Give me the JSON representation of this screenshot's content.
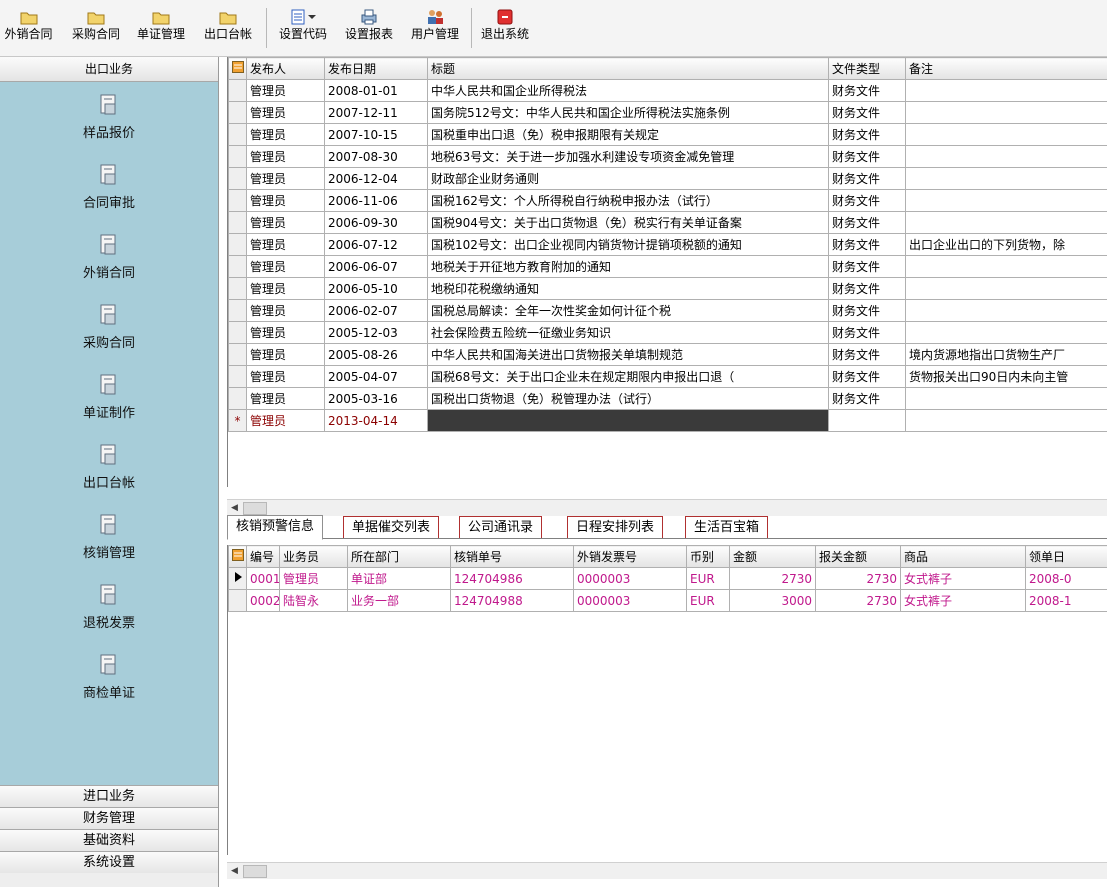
{
  "toolbar": {
    "buttons": [
      {
        "label": "外销合同",
        "icon": "folder-icon"
      },
      {
        "label": "采购合同",
        "icon": "folder-icon"
      },
      {
        "label": "单证管理",
        "icon": "folder-icon"
      },
      {
        "label": "出口台帐",
        "icon": "folder-icon"
      },
      {
        "label": "设置代码",
        "icon": "list-icon"
      },
      {
        "label": "设置报表",
        "icon": "printer-icon"
      },
      {
        "label": "用户管理",
        "icon": "users-icon"
      },
      {
        "label": "退出系统",
        "icon": "exit-icon"
      }
    ]
  },
  "sidebar": {
    "header": "出口业务",
    "items": [
      "样品报价",
      "合同审批",
      "外销合同",
      "采购合同",
      "单证制作",
      "出口台帐",
      "核销管理",
      "退税发票",
      "商检单证"
    ],
    "bottom": [
      "进口业务",
      "财务管理",
      "基础资料",
      "系统设置"
    ]
  },
  "documents": {
    "columns": [
      "发布人",
      "发布日期",
      "标题",
      "文件类型",
      "备注"
    ],
    "rows": [
      [
        "管理员",
        "2008-01-01",
        "中华人民共和国企业所得税法",
        "财务文件",
        ""
      ],
      [
        "管理员",
        "2007-12-11",
        "国务院512号文：中华人民共和国企业所得税法实施条例",
        "财务文件",
        ""
      ],
      [
        "管理员",
        "2007-10-15",
        "国税重申出口退（免）税申报期限有关规定",
        "财务文件",
        ""
      ],
      [
        "管理员",
        "2007-08-30",
        "地税63号文：关于进一步加强水利建设专项资金减免管理",
        "财务文件",
        ""
      ],
      [
        "管理员",
        "2006-12-04",
        "财政部企业财务通则",
        "财务文件",
        ""
      ],
      [
        "管理员",
        "2006-11-06",
        "国税162号文：个人所得税自行纳税申报办法（试行）",
        "财务文件",
        ""
      ],
      [
        "管理员",
        "2006-09-30",
        "国税904号文：关于出口货物退（免）税实行有关单证备案",
        "财务文件",
        ""
      ],
      [
        "管理员",
        "2006-07-12",
        "国税102号文：出口企业视同内销货物计提销项税额的通知",
        "财务文件",
        "出口企业出口的下列货物，除"
      ],
      [
        "管理员",
        "2006-06-07",
        "地税关于开征地方教育附加的通知",
        "财务文件",
        ""
      ],
      [
        "管理员",
        "2006-05-10",
        "地税印花税缴纳通知",
        "财务文件",
        ""
      ],
      [
        "管理员",
        "2006-02-07",
        "国税总局解读：全年一次性奖金如何计征个税",
        "财务文件",
        ""
      ],
      [
        "管理员",
        "2005-12-03",
        "社会保险费五险统一征缴业务知识",
        "财务文件",
        ""
      ],
      [
        "管理员",
        "2005-08-26",
        "中华人民共和国海关进出口货物报关单填制规范",
        "财务文件",
        "境内货源地指出口货物生产厂"
      ],
      [
        "管理员",
        "2005-04-07",
        "国税68号文：关于出口企业未在规定期限内申报出口退（",
        "财务文件",
        "货物报关出口90日内未向主管"
      ],
      [
        "管理员",
        "2005-03-16",
        "国税出口货物退（免）税管理办法（试行）",
        "财务文件",
        ""
      ]
    ],
    "new_row": {
      "marker": "*",
      "publisher": "管理员",
      "date": "2013-04-14"
    }
  },
  "tabs": [
    "核销预警信息",
    "单据催交列表",
    "公司通讯录",
    "日程安排列表",
    "生活百宝箱"
  ],
  "verification": {
    "columns": [
      "编号",
      "业务员",
      "所在部门",
      "核销单号",
      "外销发票号",
      "币别",
      "金额",
      "报关金额",
      "商品",
      "领单日"
    ],
    "rows": [
      [
        "0001",
        "管理员",
        "单证部",
        "124704986",
        "0000003",
        "EUR",
        "2730",
        "2730",
        "女式裤子",
        "2008-0"
      ],
      [
        "0002",
        "陆智永",
        "业务一部",
        "124704988",
        "0000003",
        "EUR",
        "3000",
        "2730",
        "女式裤子",
        "2008-1"
      ]
    ]
  },
  "colors": {
    "sidebar_panel": "#a7cdd9",
    "detail_text": "#c0188c",
    "new_row_text": "#8b0000"
  }
}
